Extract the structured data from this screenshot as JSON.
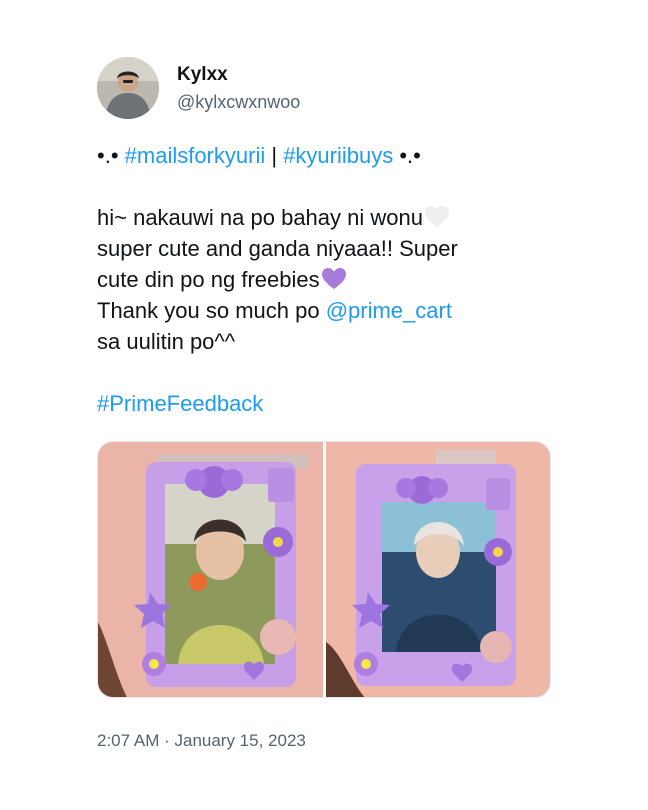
{
  "author": {
    "name": "Kylxx",
    "handle": "@kylxcwxnwoo"
  },
  "tweet": {
    "line1": {
      "prefix": "•.• ",
      "tag1": "#mailsforkyurii",
      "sep": " | ",
      "tag2": "#kyuriibuys",
      "suffix": " •.•"
    },
    "line2": "hi~ nakauwi na po bahay ni wonu",
    "line3": "super cute and ganda niyaaa!! Super",
    "line4": "cute din po ng freebies",
    "line5": {
      "text": "Thank you so much po ",
      "mention": "@prime_cart"
    },
    "line6": "sa uulitin po^^",
    "hashtag": "#PrimeFeedback"
  },
  "icons": [
    "white-heart-emoji",
    "purple-heart-emoji"
  ],
  "colors": {
    "link": "#1d9bf0",
    "text": "#0f1419",
    "secondary": "#536471",
    "white_heart": "#eceef0",
    "purple_heart": "#a77bd9"
  },
  "media": {
    "photo_count": 2
  },
  "meta": {
    "time": "2:07 AM",
    "separator": " · ",
    "date": "January 15, 2023"
  }
}
